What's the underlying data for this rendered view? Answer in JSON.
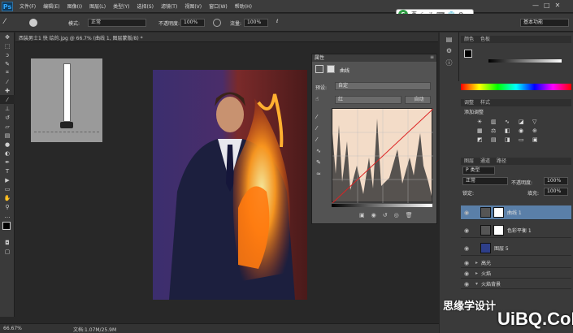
{
  "app": {
    "logo": "Ps",
    "menu": [
      "文件(F)",
      "编辑(E)",
      "图像(I)",
      "图层(L)",
      "类型(Y)",
      "选择(S)",
      "滤镜(T)",
      "视图(V)",
      "窗口(W)",
      "帮助(H)"
    ],
    "window_controls": [
      "—",
      "□",
      "✕"
    ]
  },
  "ime": {
    "logo": "S",
    "lang": "英",
    "icons": [
      "☾",
      "⁜",
      "⌨",
      "👕",
      "⚙"
    ]
  },
  "options": {
    "mode_label": "模式:",
    "mode_value": "正常",
    "opacity_label": "不透明度:",
    "opacity_value": "100%",
    "flow_label": "流量:",
    "flow_value": "100%",
    "workspace": "基本功能"
  },
  "document": {
    "tab_title": "西装男士1 快 绘的.jpg @ 66.7% (曲线 1, 图层蒙版/8) *",
    "zoom": "66.67%",
    "doc_size": "文档:1.07M/25.9M"
  },
  "properties": {
    "title": "属性",
    "panel_name": "曲线",
    "preset_label": "预设:",
    "preset_value": "自定",
    "channel_value": "红",
    "auto_button": "自动"
  },
  "swatches": {
    "tabs": [
      "颜色",
      "色板"
    ]
  },
  "adjustments": {
    "tabs": [
      "调整",
      "样式"
    ],
    "add_label": "添加调整"
  },
  "layers": {
    "tabs": [
      "图层",
      "通道",
      "路径"
    ],
    "kind_label": "P 类型",
    "blend": "正常",
    "opacity_label": "不透明度:",
    "opacity_value": "100%",
    "lock_label": "锁定:",
    "fill_label": "填充:",
    "fill_value": "100%",
    "items": [
      {
        "name": "曲线 1"
      },
      {
        "name": "色彩平衡 1"
      },
      {
        "name": "图层 5"
      },
      {
        "name": "高光"
      },
      {
        "name": "火焰"
      },
      {
        "name": "火焰背景"
      }
    ]
  },
  "watermark": {
    "brand": "思缘学设计",
    "site": "UiBQ.CoM"
  },
  "colors": {
    "accent": "#31a8ff",
    "selected_layer": "#5a7fa8"
  }
}
